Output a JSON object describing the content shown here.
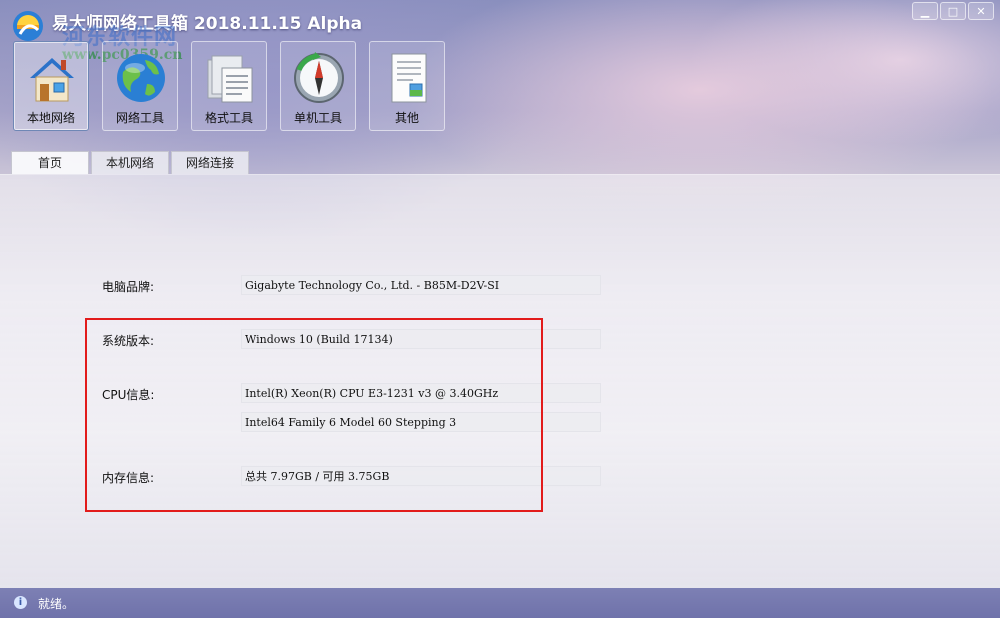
{
  "titlebar": {
    "title": "易大师网络工具箱   2018.11.15   Alpha",
    "watermark": "河东软件网",
    "watermark_url": "www.pc0359.cn",
    "minimize": "▁",
    "maximize": "□",
    "close": "✕"
  },
  "toolbar": [
    {
      "label": "本地网络",
      "icon": "house-icon"
    },
    {
      "label": "网络工具",
      "icon": "globe-icon"
    },
    {
      "label": "格式工具",
      "icon": "folder-icon"
    },
    {
      "label": "单机工具",
      "icon": "compass-icon"
    },
    {
      "label": "其他",
      "icon": "document-icon"
    }
  ],
  "tabs": [
    "首页",
    "本机网络",
    "网络连接"
  ],
  "info": {
    "brand_label": "电脑品牌:",
    "brand_value": "Gigabyte Technology Co., Ltd. - B85M-D2V-SI",
    "os_label": "系统版本:",
    "os_value": "Windows 10 (Build 17134)",
    "cpu_label": "CPU信息:",
    "cpu_value_1": "Intel(R) Xeon(R) CPU E3-1231 v3 @ 3.40GHz",
    "cpu_value_2": "Intel64 Family 6 Model 60 Stepping 3",
    "mem_label": "内存信息:",
    "mem_value": "总共 7.97GB / 可用 3.75GB"
  },
  "status": {
    "icon": "info-icon",
    "text": "就绪。"
  },
  "colors": {
    "highlight_box": "#e21b1b",
    "status_bar": "#7276ad"
  }
}
